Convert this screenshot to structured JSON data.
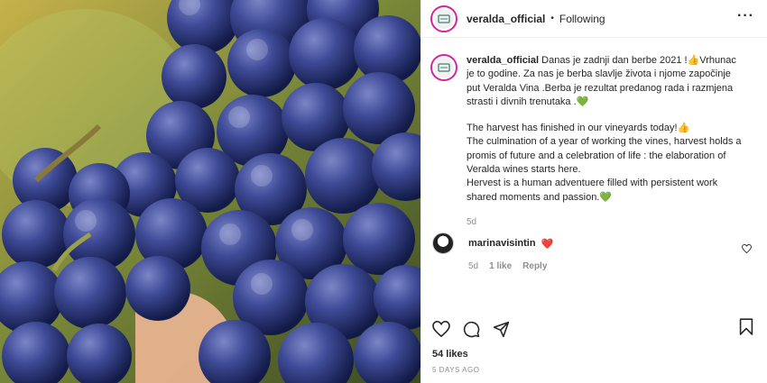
{
  "post": {
    "username": "veralda_official",
    "follow_status": "Following",
    "caption": {
      "user": "veralda_official",
      "text_hr": " Danas je zadnji dan berbe 2021 !👍Vrhunac je to godine. Za nas je berba slavlje života i njome započinje put Veralda Vina .Berba je rezultat predanog rada i razmjena strasti i divnih trenutaka .💚",
      "text_en_1": "The harvest has finished in our vineyards today!👍",
      "text_en_2": "The culmination of a year of working the vines, harvest holds a promis of future and a celebration of life : the elaboration of Veralda wines starts here.",
      "text_en_3": "Hervest is a human adventuere filled with persistent work shared moments and passion.💚",
      "age": "5d"
    },
    "comment": {
      "user": "marinavisintin",
      "text": "❤️",
      "age": "5d",
      "likes": "1 like",
      "reply": "Reply"
    },
    "likes": "54 likes",
    "posted": "5 DAYS AGO"
  },
  "colors": {
    "accent_ring": "#d6249f",
    "heart_red": "#ed1c24",
    "heart_green": "#2dbf3a",
    "muted": "#8e8e8e"
  },
  "icons": [
    "more-icon",
    "heart-icon",
    "comment-icon",
    "share-icon",
    "bookmark-icon"
  ]
}
